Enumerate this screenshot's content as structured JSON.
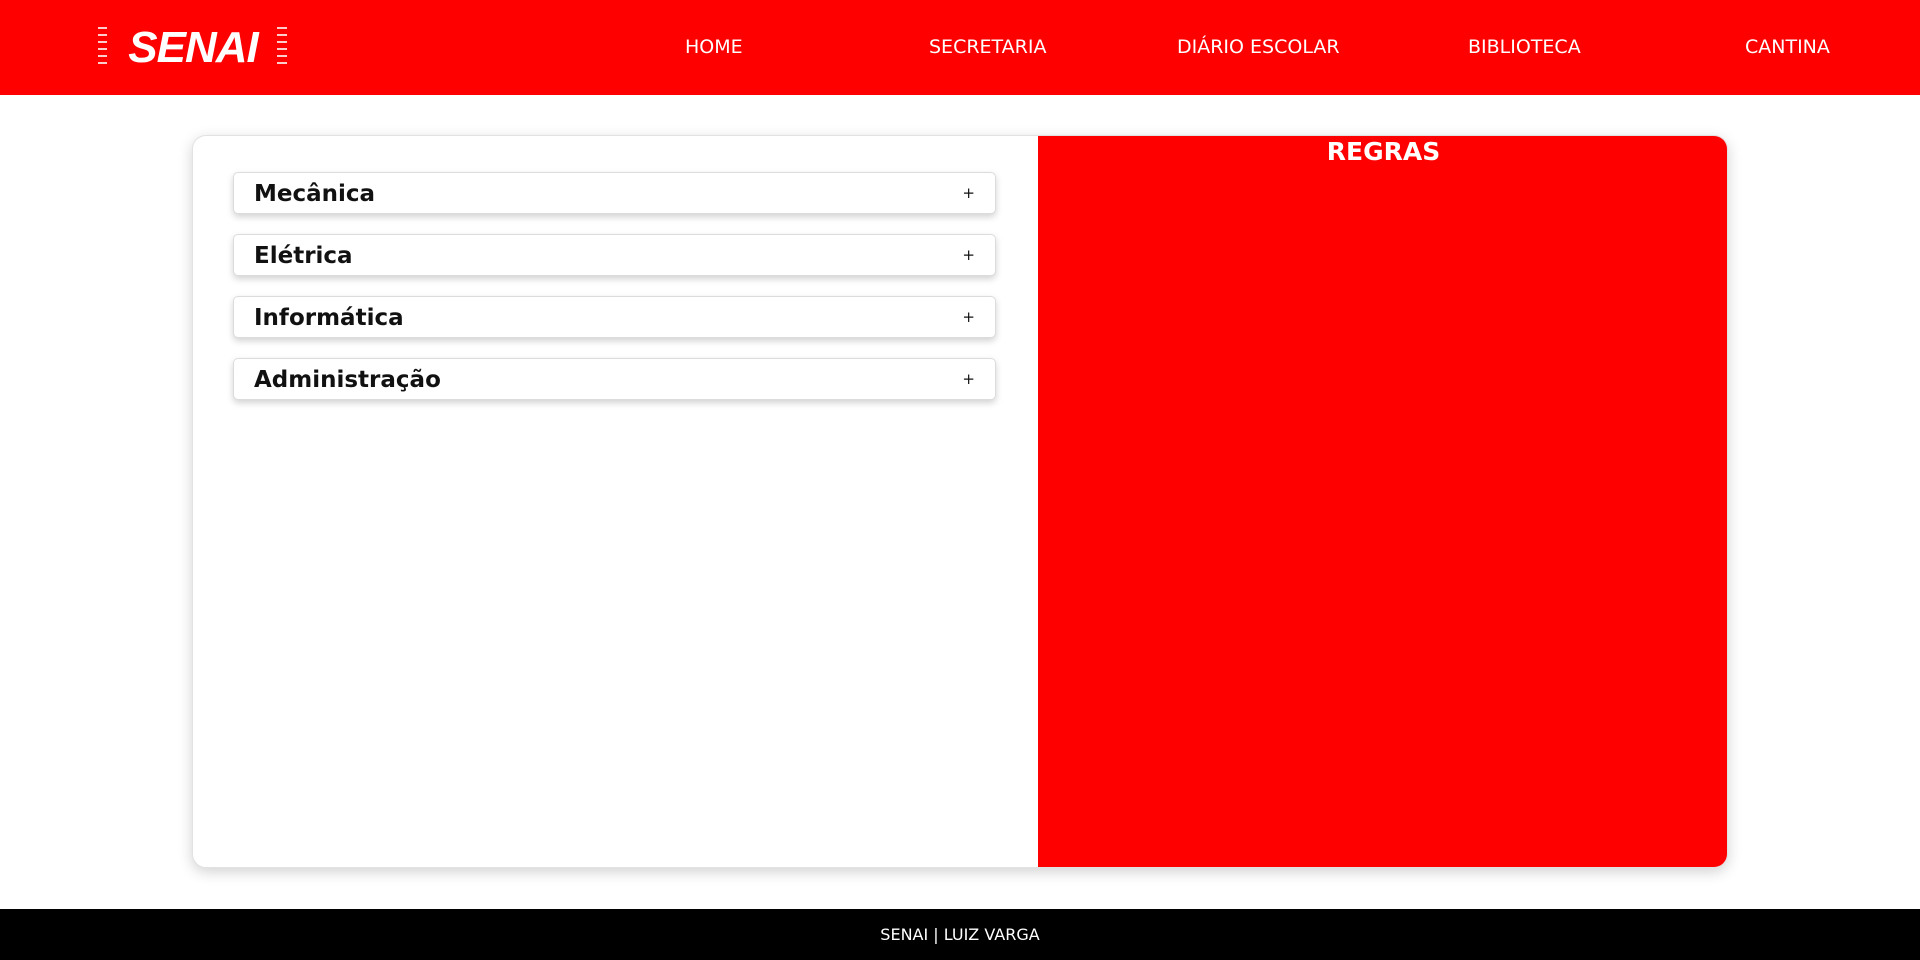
{
  "brand": {
    "logo_text": "SENAI",
    "color": "#ff0000"
  },
  "nav": {
    "items": [
      {
        "label": "HOME"
      },
      {
        "label": "SECRETARIA"
      },
      {
        "label": "DIÁRIO ESCOLAR"
      },
      {
        "label": "BIBLIOTECA"
      },
      {
        "label": "CANTINA"
      }
    ]
  },
  "courses": {
    "items": [
      {
        "label": "Mecânica",
        "toggle": "+"
      },
      {
        "label": "Elétrica",
        "toggle": "+"
      },
      {
        "label": "Informática",
        "toggle": "+"
      },
      {
        "label": "Administração",
        "toggle": "+"
      }
    ]
  },
  "rules": {
    "title": "REGRAS"
  },
  "footer": {
    "text": "SENAI | LUIZ VARGA"
  },
  "colors": {
    "accent": "#ff0000",
    "footer_bg": "#000000",
    "page_bg": "#ffffff"
  }
}
